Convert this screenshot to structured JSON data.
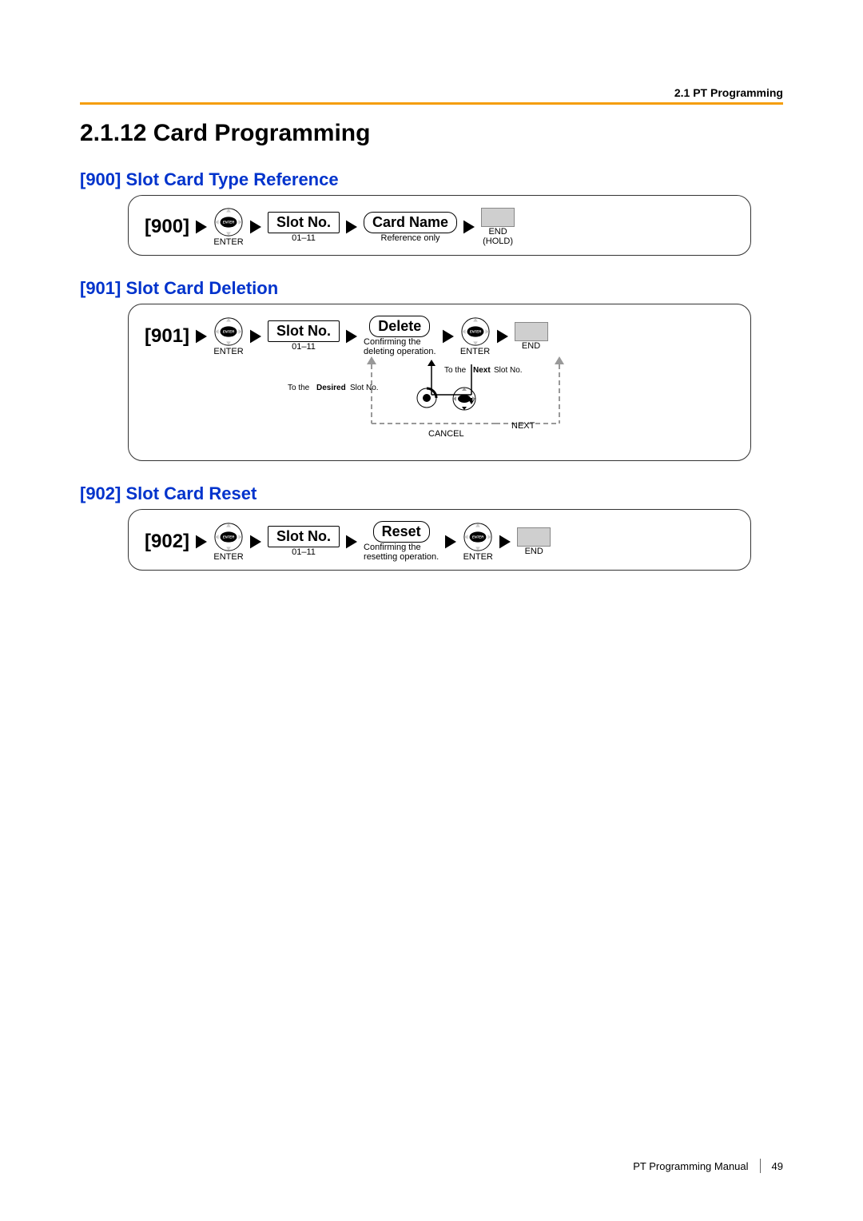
{
  "header": {
    "section": "2.1 PT Programming"
  },
  "heading": "2.1.12  Card Programming",
  "s900": {
    "title": "[900] Slot Card Type Reference",
    "code": "[900]",
    "enter": "ENTER",
    "slot": "Slot No.",
    "slot_range": "01–11",
    "op": "Card Name",
    "op_note": "Reference only",
    "end": "END",
    "hold": "(HOLD)"
  },
  "s901": {
    "title": "[901] Slot Card Deletion",
    "code": "[901]",
    "enter1": "ENTER",
    "slot": "Slot No.",
    "slot_range": "01–11",
    "op": "Delete",
    "op_note1": "Confirming the",
    "op_note2": "deleting operation.",
    "enter2": "ENTER",
    "end": "END",
    "to_next1": "To the ",
    "to_next2": "Next",
    "to_next3": " Slot No.",
    "to_desired1": "To the ",
    "to_desired2": "Desired",
    "to_desired3": " Slot No.",
    "cancel": "CANCEL",
    "next": "NEXT"
  },
  "s902": {
    "title": "[902] Slot Card Reset",
    "code": "[902]",
    "enter1": "ENTER",
    "slot": "Slot No.",
    "slot_range": "01–11",
    "op": "Reset",
    "op_note1": "Confirming the",
    "op_note2": "resetting operation.",
    "enter2": "ENTER",
    "end": "END"
  },
  "footer": {
    "manual": "PT Programming Manual",
    "page": "49"
  }
}
